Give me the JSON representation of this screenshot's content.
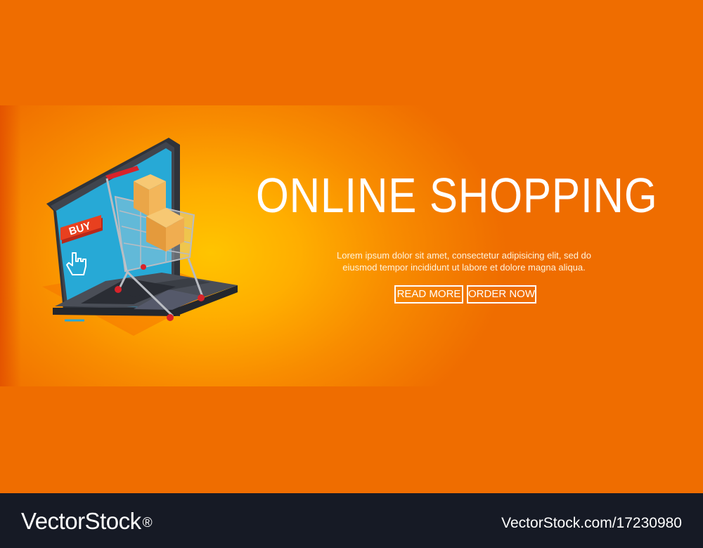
{
  "banner": {
    "title": "ONLINE SHOPPING",
    "description_line1": "Lorem ipsum dolor sit amet, consectetur adipisicing elit, sed do",
    "description_line2": "eiusmod tempor incididunt ut labore et dolore magna aliqua.",
    "read_more_label": "READ MORE",
    "order_now_label": "ORDER NOW"
  },
  "illustration": {
    "laptop_screen_button_label": "BUY",
    "icons": [
      "laptop-icon",
      "shopping-cart-icon",
      "box-icon",
      "hand-cursor-icon"
    ]
  },
  "footer": {
    "logo_text": "VectorStock",
    "logo_mark": "®",
    "stock_url": "VectorStock.com/17230980"
  },
  "colors": {
    "background": "#ef6d00",
    "banner_glow": "#ffc400",
    "text": "#ffffff",
    "screen": "#27a9d6",
    "buy_button": "#e8401f",
    "laptop_body": "#3a3d44",
    "footer": "#161a25"
  }
}
